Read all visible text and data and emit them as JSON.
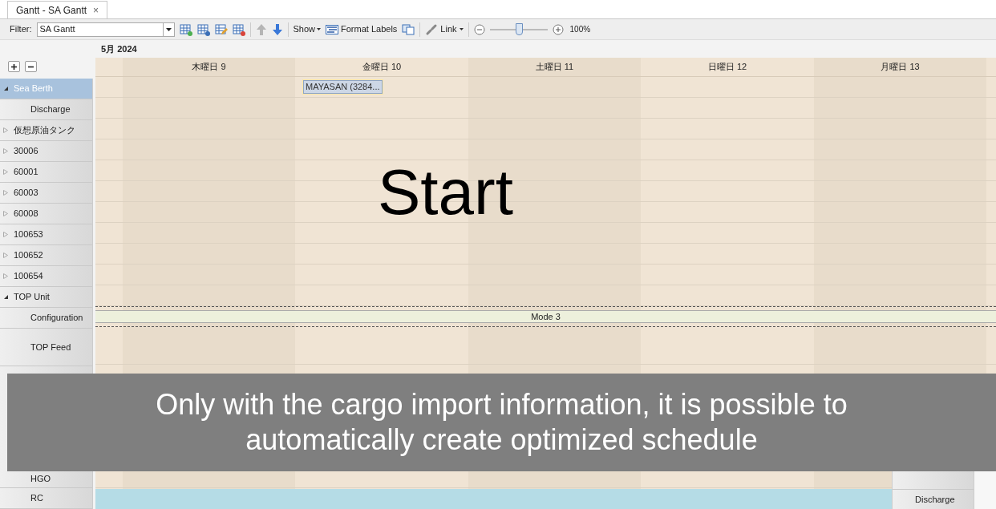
{
  "tabs": [
    {
      "label": "Gantt - SA Gantt",
      "close": "×",
      "selected": true
    }
  ],
  "toolbar": {
    "filter_label": "Filter:",
    "filter_value": "SA Gantt",
    "show": "Show",
    "format_labels": "Format Labels",
    "link": "Link",
    "zoom": {
      "level": 0.5,
      "reading": "100%"
    }
  },
  "month": "5月 2024",
  "days": [
    {
      "label": "木曜日 9"
    },
    {
      "label": "金曜日 10"
    },
    {
      "label": "土曜日 11"
    },
    {
      "label": "日曜日 12"
    },
    {
      "label": "月曜日 13"
    }
  ],
  "rows": [
    {
      "label": "Sea Berth",
      "expanded": true,
      "selected": true,
      "task": {
        "label": "MAYASAN (3284...",
        "kind": "cargo"
      },
      "children": [
        {
          "label": "Discharge",
          "selected": false
        }
      ]
    },
    {
      "label": "仮想原油タンク",
      "expanded": false,
      "selected": false
    },
    {
      "label": "30006",
      "expanded": false,
      "selected": false
    },
    {
      "label": "60001",
      "expanded": false,
      "selected": false
    },
    {
      "label": "60003",
      "expanded": false,
      "selected": false
    },
    {
      "label": "60008",
      "expanded": false,
      "selected": false
    },
    {
      "label": "100653",
      "expanded": false,
      "selected": false
    },
    {
      "label": "100652",
      "expanded": false,
      "selected": false
    },
    {
      "label": "100654",
      "expanded": false,
      "selected": false
    },
    {
      "label": "TOP Unit",
      "expanded": true,
      "selected": false,
      "children": [
        {
          "label": "Configuration",
          "selected": false,
          "task": {
            "label": "Mode 3",
            "kind": "mode"
          }
        },
        {
          "label": "TOP Feed",
          "selected": false,
          "tall": true
        },
        {
          "label": "HGO",
          "selected": false
        },
        {
          "label": "RC",
          "selected": false
        }
      ]
    }
  ],
  "start_caption": "Start",
  "banner": "Only with the cargo import information, it is possible to automatically create optimized schedule",
  "inset": {
    "row_label": "Discharge"
  }
}
